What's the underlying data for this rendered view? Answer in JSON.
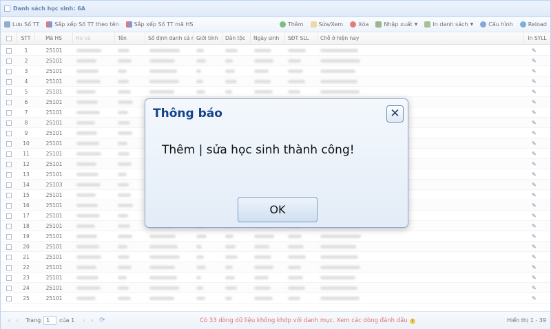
{
  "panel": {
    "title": "Danh sách học sinh: 6A"
  },
  "toolbar": {
    "luu_stt": "Lưu Số TT",
    "sort_name": "Sắp xếp Số TT theo tên",
    "sort_code": "Sắp xếp Số TT mã HS",
    "them": "Thêm",
    "suaxem": "Sửa/Xem",
    "xoa": "Xóa",
    "nhapxuat": "Nhập xuất",
    "indanhsach": "In danh sách",
    "cauhinh": "Cấu hình",
    "reload": "Reload"
  },
  "grid": {
    "headers": {
      "stt": "STT",
      "mahs": "Mã HS",
      "hovoten": "Họ và",
      "ten": "Tên",
      "sodinhdanh": "Số định danh cá nhâ",
      "gioitinh": "Giới tính",
      "dantoc": "Dân tộc",
      "ngaysinh": "Ngày sinh",
      "sdt": "SĐT SLL",
      "chon": "Chỗ ở hiện nay",
      "insyll": "In SYLL"
    },
    "rows": [
      {
        "stt": "1",
        "mahs": "25101"
      },
      {
        "stt": "2",
        "mahs": "25101"
      },
      {
        "stt": "3",
        "mahs": "25101"
      },
      {
        "stt": "4",
        "mahs": "25101"
      },
      {
        "stt": "5",
        "mahs": "25101"
      },
      {
        "stt": "6",
        "mahs": "25101"
      },
      {
        "stt": "7",
        "mahs": "25101"
      },
      {
        "stt": "8",
        "mahs": "25101"
      },
      {
        "stt": "9",
        "mahs": "25101"
      },
      {
        "stt": "10",
        "mahs": "25101"
      },
      {
        "stt": "11",
        "mahs": "25101"
      },
      {
        "stt": "12",
        "mahs": "25101"
      },
      {
        "stt": "13",
        "mahs": "25101"
      },
      {
        "stt": "14",
        "mahs": "25103"
      },
      {
        "stt": "15",
        "mahs": "25101"
      },
      {
        "stt": "16",
        "mahs": "25101"
      },
      {
        "stt": "17",
        "mahs": "25101"
      },
      {
        "stt": "18",
        "mahs": "25101"
      },
      {
        "stt": "19",
        "mahs": "25101"
      },
      {
        "stt": "20",
        "mahs": "25101"
      },
      {
        "stt": "21",
        "mahs": "25101"
      },
      {
        "stt": "22",
        "mahs": "25101"
      },
      {
        "stt": "23",
        "mahs": "25101"
      },
      {
        "stt": "24",
        "mahs": "25101"
      },
      {
        "stt": "25",
        "mahs": "25101"
      }
    ]
  },
  "footer": {
    "trang_label": "Trang",
    "page_value": "1",
    "cua_label": "của 1",
    "warning": "Có 33 dòng dữ liệu không khớp với danh mục. Xem các dòng đánh dấu",
    "hien_thi": "Hiển thị 1 - 39"
  },
  "dialog": {
    "title": "Thông báo",
    "message": "Thêm | sửa học sinh thành công!",
    "ok_label": "OK"
  },
  "icons": {
    "edit": "pencil-icon",
    "add": "plus-circle-icon",
    "delete": "x-circle-icon",
    "refresh": "refresh-icon",
    "close": "close-icon"
  },
  "colors": {
    "title_blue": "#15428b",
    "warning_red": "#cc2222",
    "add_green": "#3a9a3a",
    "delete_red": "#d33a2c"
  }
}
